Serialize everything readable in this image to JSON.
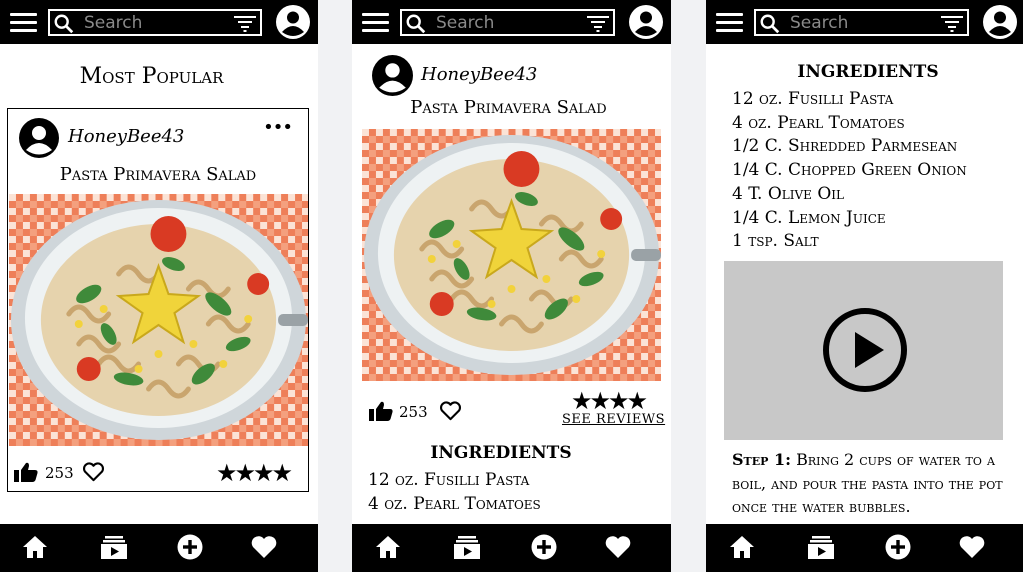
{
  "screens": [
    {
      "search": {
        "placeholder": "Search"
      },
      "page_title": "Most Popular",
      "card": {
        "username": "HoneyBee43",
        "more": "•••",
        "recipe_title": "Pasta Primavera Salad",
        "likes": "253",
        "rating": 4,
        "stars": "★★★★"
      }
    },
    {
      "search": {
        "placeholder": "Search"
      },
      "username": "HoneyBee43",
      "recipe_title": "Pasta Primavera Salad",
      "likes": "253",
      "rating": 4,
      "stars": "★★★★",
      "see_reviews": "SEE REVIEWS",
      "ingredients_heading": "INGREDIENTS",
      "ingredients": [
        "12 oz. Fusilli Pasta",
        "4 oz. Pearl Tomatoes"
      ]
    },
    {
      "search": {
        "placeholder": "Search"
      },
      "ingredients_heading": "INGREDIENTS",
      "ingredients": [
        "12 oz. Fusilli Pasta",
        "4 oz. Pearl Tomatoes",
        "1/2 C. Shredded Parmesean",
        "1/4 C. Chopped Green Onion",
        "4 T. Olive Oil",
        "1/4 C. Lemon Juice",
        "1 tsp. Salt"
      ],
      "step": {
        "label": "Step 1:",
        "text": "Bring 2 cups of water to a boil, and pour the pasta into the pot once the water bubbles."
      }
    }
  ],
  "nav": {
    "icons": [
      "home-icon",
      "recipe-box-icon",
      "add-icon",
      "favorites-icon"
    ]
  },
  "colors": {
    "bar": "#000000",
    "background": "#ffffff",
    "gutter": "#f1f2f4",
    "video_placeholder": "#c8c8c8",
    "tablecloth": "#e8643a"
  }
}
